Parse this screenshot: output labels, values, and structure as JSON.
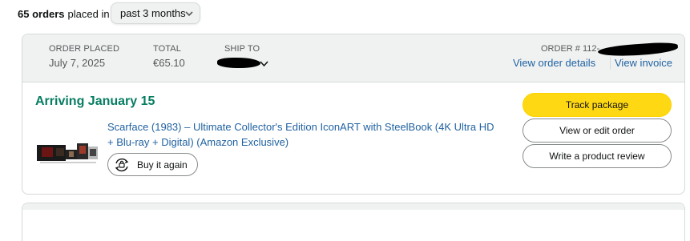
{
  "filter": {
    "count": "65 orders",
    "placed_in": "placed in",
    "period": "past 3 months"
  },
  "order": {
    "placed_label": "ORDER PLACED",
    "placed_date": "July 7, 2025",
    "total_label": "TOTAL",
    "total_value": "€65.10",
    "ship_to_label": "SHIP TO",
    "order_number_label": "ORDER # 112-",
    "view_details": "View order details",
    "view_invoice": "View invoice",
    "arriving": "Arriving January 15",
    "product_title": "Scarface (1983) – Ultimate Collector's Edition IconART with SteelBook (4K Ultra HD + Blu-ray + Digital) (Amazon Exclusive)",
    "buy_again": "Buy it again",
    "actions": {
      "track": "Track package",
      "view_edit": "View or edit order",
      "review": "Write a product review"
    }
  },
  "colors": {
    "link": "#2162a1",
    "arriving": "#067d62",
    "track_button": "#ffd814",
    "header_bg": "#f0f2f2"
  }
}
